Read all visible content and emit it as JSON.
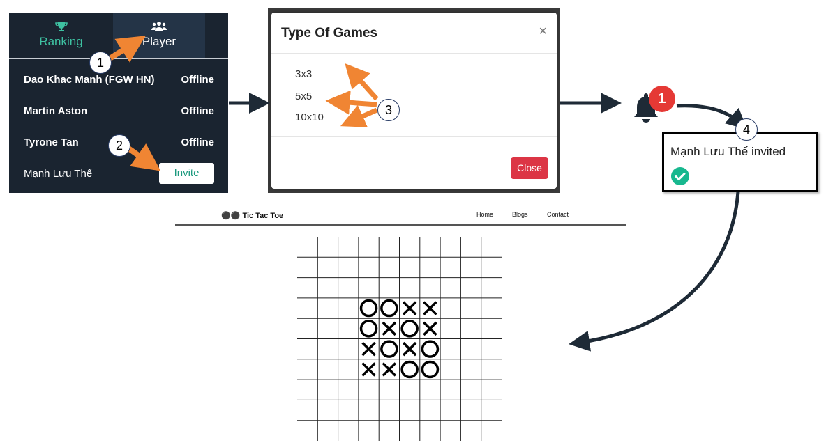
{
  "panel1": {
    "tabs": [
      {
        "label": "Ranking",
        "icon": "trophy-icon"
      },
      {
        "label": "Player",
        "icon": "users-icon"
      }
    ],
    "players": [
      {
        "name": "Dao Khac Manh (FGW HN)",
        "status": "Offline"
      },
      {
        "name": "Martin Aston",
        "status": "Offline"
      },
      {
        "name": "Tyrone Tan",
        "status": "Offline"
      },
      {
        "name": "Mạnh Lưu Thế",
        "status": ""
      }
    ],
    "invite_label": "Invite",
    "colors": {
      "bg": "#1a2430",
      "accent": "#3ec2a2"
    }
  },
  "modal": {
    "title": "Type Of Games",
    "close_x": "×",
    "options": [
      "3x3",
      "5x5",
      "10x10"
    ],
    "close_label": "Close",
    "close_color": "#dc3545"
  },
  "notification": {
    "badge_count": "1",
    "message": "Mạnh Lưu Thế invited",
    "icon": "check-circle-icon",
    "badge_color": "#e53935"
  },
  "steps": [
    "1",
    "2",
    "3",
    "4"
  ],
  "game": {
    "brand": "Tic Tac Toe",
    "nav": [
      "Home",
      "Blogs",
      "Contact"
    ],
    "board_rows": [
      [
        "O",
        "O",
        "X",
        "X"
      ],
      [
        "O",
        "X",
        "O",
        "X"
      ],
      [
        "X",
        "O",
        "X",
        "O"
      ],
      [
        "X",
        "X",
        "O",
        "O"
      ]
    ]
  },
  "arrow_color": "#f08533"
}
